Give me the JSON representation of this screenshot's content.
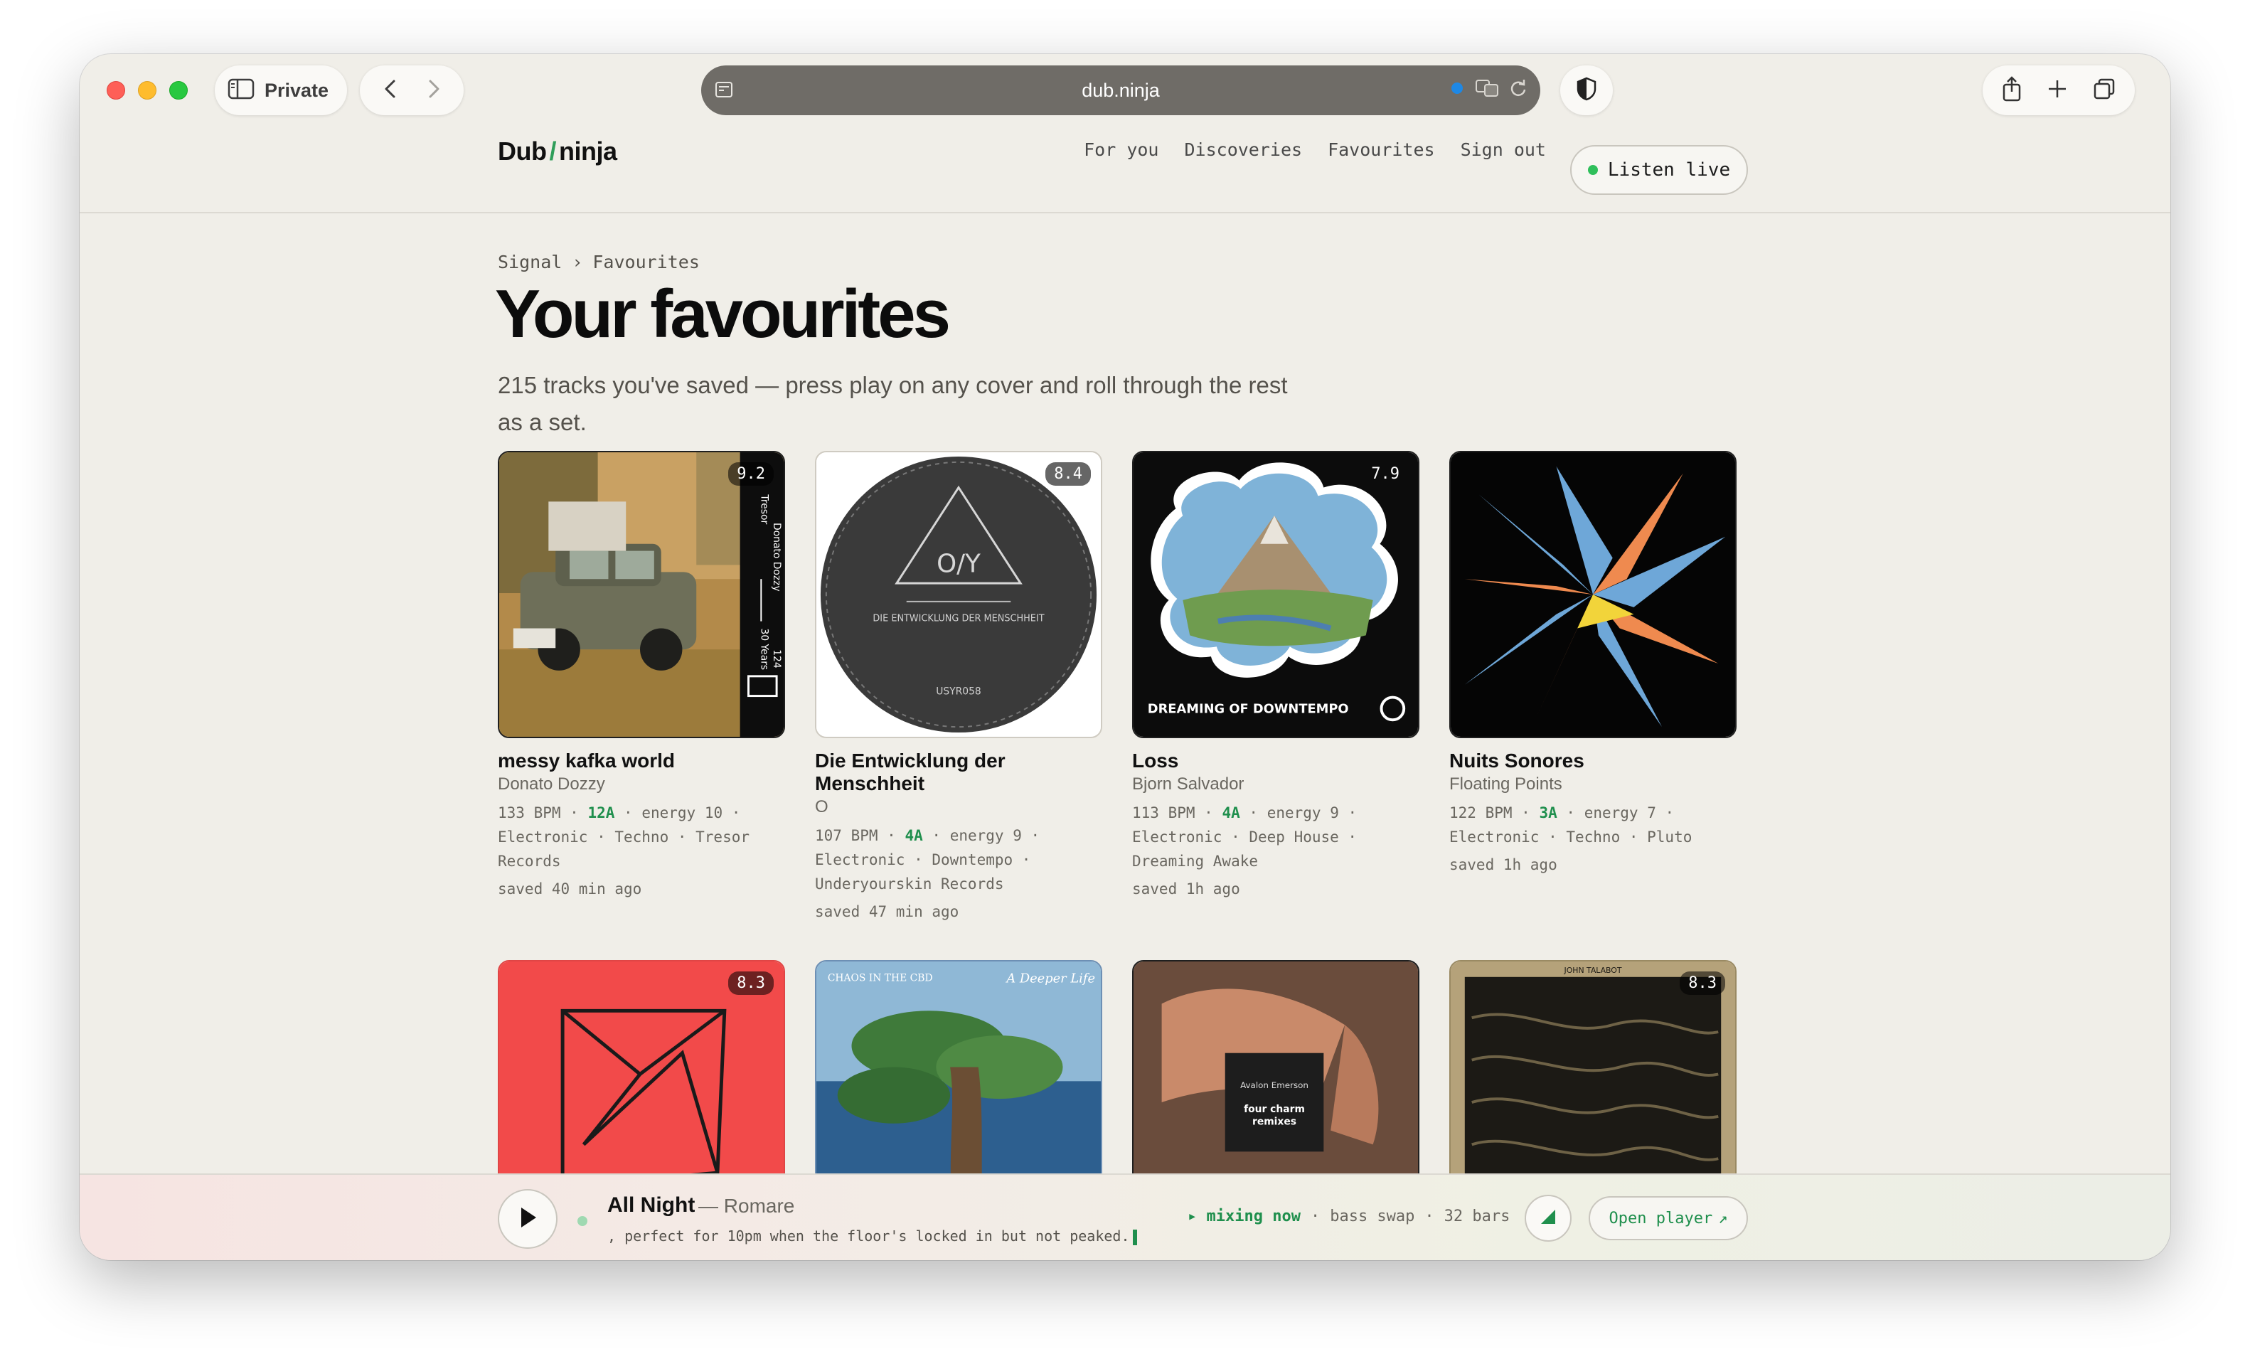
{
  "browser": {
    "private_label": "Private",
    "url": "dub.ninja"
  },
  "site": {
    "logo_left": "Dub",
    "logo_slash": "/",
    "logo_right": "ninja",
    "nav": [
      "For you",
      "Discoveries",
      "Favourites",
      "Sign out"
    ],
    "listen_live": "Listen live"
  },
  "breadcrumb": {
    "root": "Signal",
    "separator": "›",
    "current": "Favourites"
  },
  "page": {
    "title": "Your favourites",
    "subtitle": "215 tracks you've saved — press play on any cover and roll through the rest as a set."
  },
  "tracks": [
    {
      "rating": "9.2",
      "title": "messy kafka world",
      "artist": "Donato Dozzy",
      "bpm": "133 BPM",
      "key": "12A",
      "energy": "energy 10",
      "genres": "Electronic · Techno · Tresor Records",
      "saved": "saved 40 min ago",
      "cover_text": [
        "Tresor",
        "Donato Dozzy",
        "30 Years",
        "124"
      ]
    },
    {
      "rating": "8.4",
      "title": "Die Entwicklung der Menschheit",
      "artist": "O",
      "bpm": "107 BPM",
      "key": "4A",
      "energy": "energy 9",
      "genres": "Electronic · Downtempo · Underyourskin Records",
      "saved": "saved 47 min ago",
      "cover_text": [
        "O/Y",
        "DIE ENTWICKLUNG DER MENSCHHEIT",
        "USYR058"
      ]
    },
    {
      "rating": "7.9",
      "title": "Loss",
      "artist": "Bjorn Salvador",
      "bpm": "113 BPM",
      "key": "4A",
      "energy": "energy 9",
      "genres": "Electronic · Deep House · Dreaming Awake",
      "saved": "saved 1h ago",
      "cover_text": [
        "DREAMING OF DOWNTEMPO"
      ]
    },
    {
      "rating": "",
      "title": "Nuits Sonores",
      "artist": "Floating Points",
      "bpm": "122 BPM",
      "key": "3A",
      "energy": "energy 7",
      "genres": "Electronic · Techno · Pluto",
      "saved": "saved 1h ago",
      "cover_text": []
    },
    {
      "rating": "8.3",
      "cover_text": []
    },
    {
      "rating": "",
      "cover_text": [
        "CHAOS IN THE CBD",
        "A Deeper Life"
      ]
    },
    {
      "rating": "",
      "cover_text": [
        "Avalon Emerson",
        "four charm",
        "remixes"
      ]
    },
    {
      "rating": "8.3",
      "cover_text": [
        "JOHN TALABOT"
      ]
    }
  ],
  "player": {
    "title": "All Night",
    "artist": "— Romare",
    "note": ", perfect for 10pm when the floor's locked in but not peaked.",
    "mixing": "▸ mixing now",
    "swap": "bass swap",
    "bars": "32 bars",
    "dot_sep": "·",
    "open_player": "Open player",
    "open_icon": "↗"
  },
  "colors": {
    "accent": "#1f8f4d",
    "background": "#f0eee8",
    "live_dot": "#2fbf5b"
  }
}
